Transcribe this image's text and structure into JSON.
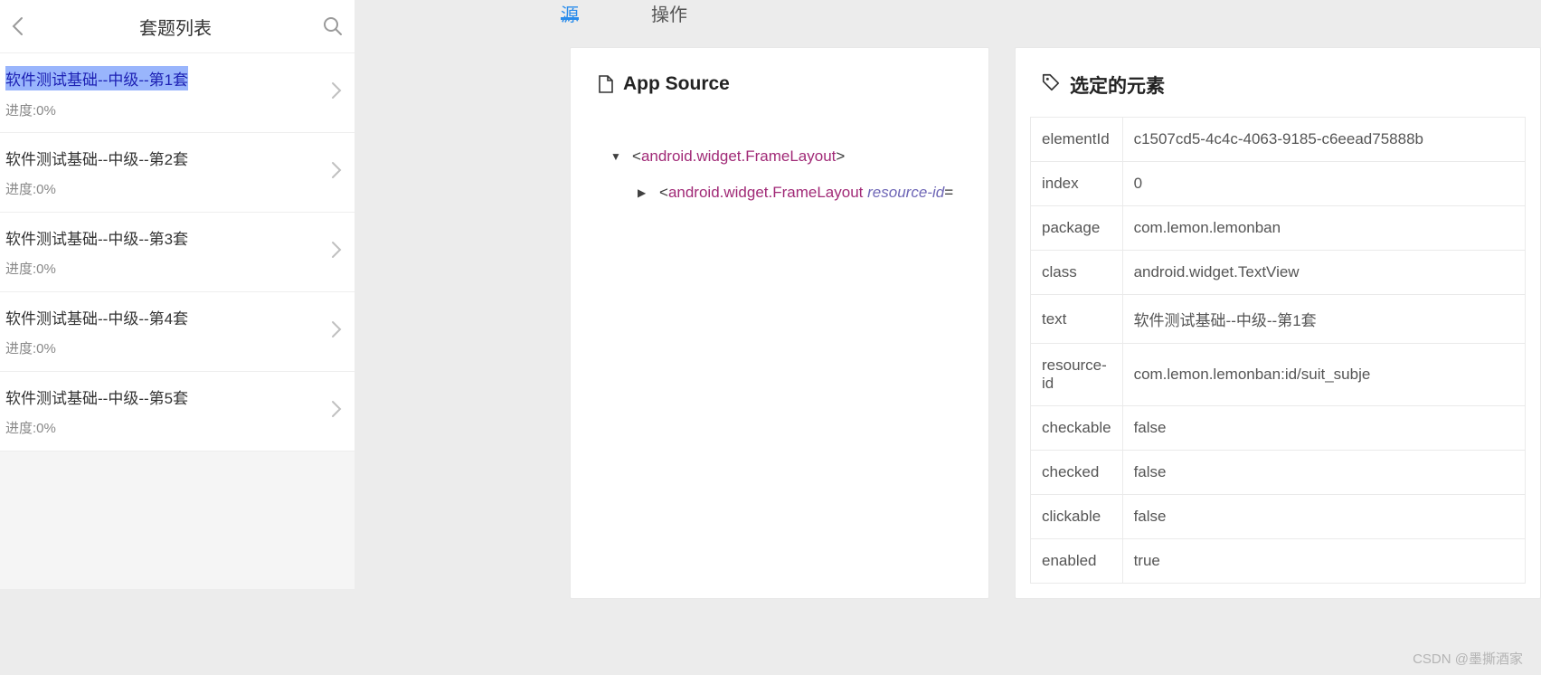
{
  "phone": {
    "title": "套题列表",
    "items": [
      {
        "title": "软件测试基础--中级--第1套",
        "progress": "进度:0%",
        "selected": true
      },
      {
        "title": "软件测试基础--中级--第2套",
        "progress": "进度:0%",
        "selected": false
      },
      {
        "title": "软件测试基础--中级--第3套",
        "progress": "进度:0%",
        "selected": false
      },
      {
        "title": "软件测试基础--中级--第4套",
        "progress": "进度:0%",
        "selected": false
      },
      {
        "title": "软件测试基础--中级--第5套",
        "progress": "进度:0%",
        "selected": false
      }
    ]
  },
  "tabs": {
    "source": "源",
    "action": "操作"
  },
  "source_panel": {
    "title": "App Source",
    "tree": {
      "node1_tag": "android.widget.FrameLayout",
      "node2_tag": "android.widget.FrameLayout",
      "node2_attr": "resource-id"
    }
  },
  "detail_panel": {
    "title": "选定的元素",
    "rows": [
      {
        "key": "elementId",
        "value": "c1507cd5-4c4c-4063-9185-c6eead75888b"
      },
      {
        "key": "index",
        "value": "0"
      },
      {
        "key": "package",
        "value": "com.lemon.lemonban"
      },
      {
        "key": "class",
        "value": "android.widget.TextView"
      },
      {
        "key": "text",
        "value": "软件测试基础--中级--第1套"
      },
      {
        "key": "resource-id",
        "value": "com.lemon.lemonban:id/suit_subje"
      },
      {
        "key": "checkable",
        "value": "false"
      },
      {
        "key": "checked",
        "value": "false"
      },
      {
        "key": "clickable",
        "value": "false"
      },
      {
        "key": "enabled",
        "value": "true"
      }
    ]
  },
  "watermark": "CSDN @墨撕酒家"
}
